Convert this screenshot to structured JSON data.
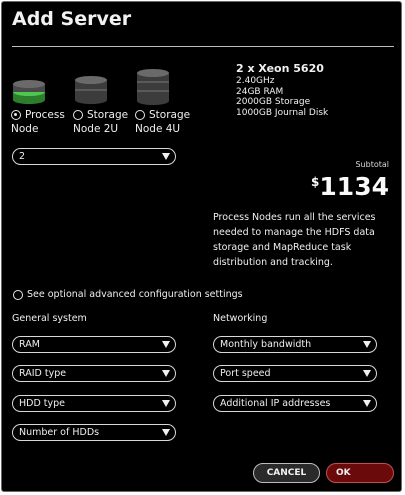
{
  "dialog": {
    "title": "Add Server"
  },
  "server_types": [
    {
      "label_line1": "Process",
      "label_line2": "Node",
      "selected": true,
      "icon": "green-server-icon",
      "color": "#3aa63a"
    },
    {
      "label_line1": "Storage",
      "label_line2": "Node 2U",
      "selected": false,
      "icon": "gray-server-2u-icon",
      "color": "#666666"
    },
    {
      "label_line1": "Storage",
      "label_line2": "Node 4U",
      "selected": false,
      "icon": "gray-server-4u-icon",
      "color": "#666666"
    }
  ],
  "specs": {
    "heading": "2 x Xeon 5620",
    "lines": [
      "2.40GHz",
      "24GB RAM",
      "2000GB Storage",
      "1000GB Journal Disk"
    ]
  },
  "quantity": {
    "value": "2"
  },
  "subtotal": {
    "label": "Subtotal",
    "currency": "$",
    "amount": "1134"
  },
  "description": "Process Nodes run all the services needed to manage the HDFS data storage and MapReduce task distribution and tracking.",
  "advanced": {
    "label": "See optional advanced configuration settings"
  },
  "general_system": {
    "heading": "General system",
    "selects": [
      "RAM",
      "RAID type",
      "HDD type",
      "Number of HDDs"
    ]
  },
  "networking": {
    "heading": "Networking",
    "selects": [
      "Monthly bandwidth",
      "Port speed",
      "Additional IP addresses"
    ]
  },
  "buttons": {
    "cancel": "CANCEL",
    "ok": "OK"
  },
  "colors": {
    "background": "#000000",
    "ok_button": "#6b0a0a",
    "accent_green": "#3aa63a"
  }
}
